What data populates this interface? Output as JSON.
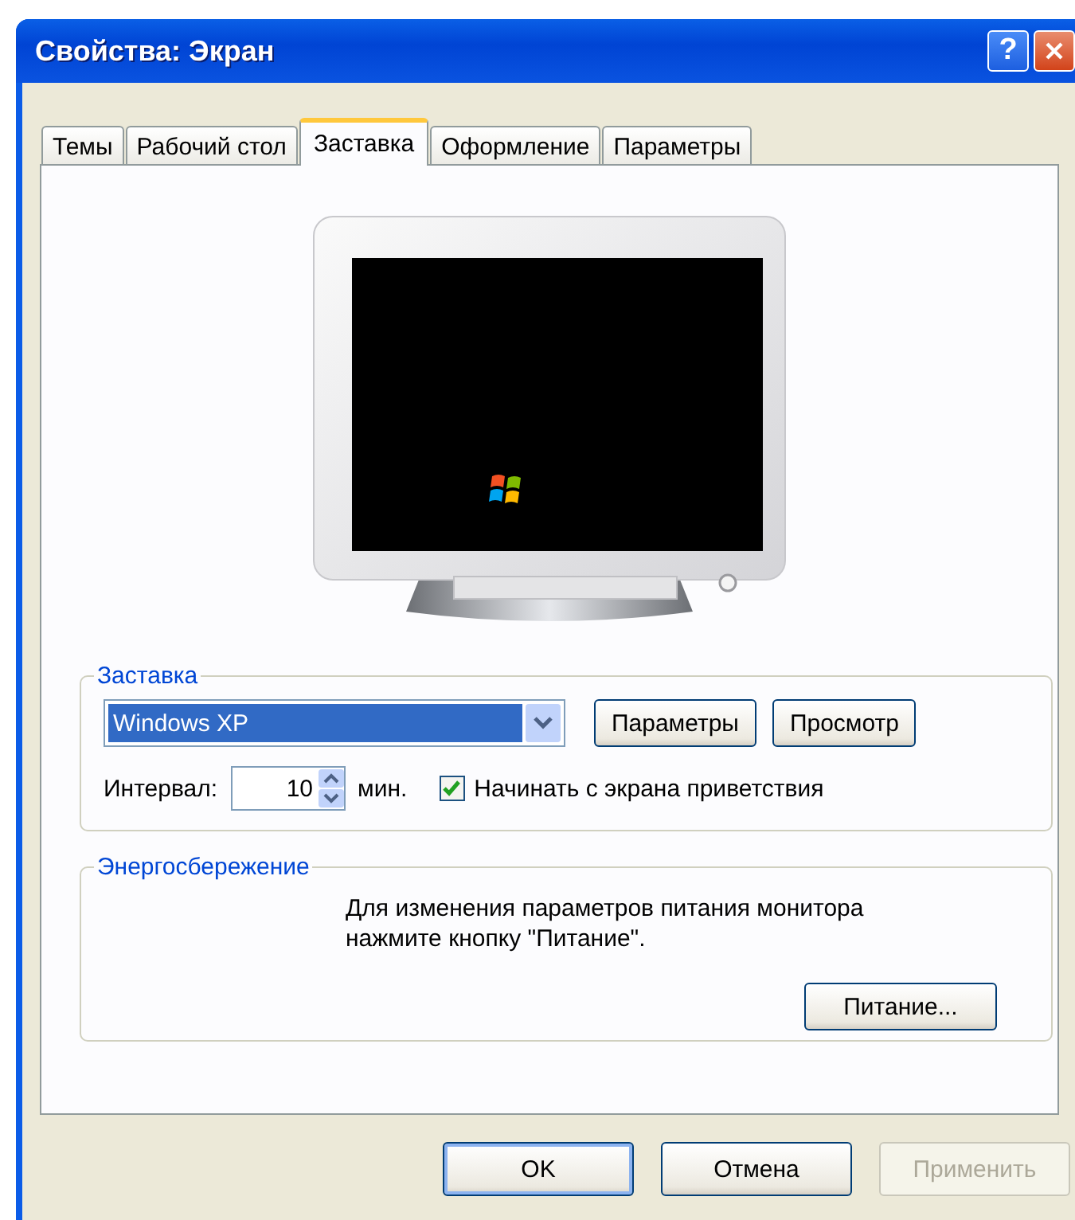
{
  "window": {
    "title": "Свойства: Экран"
  },
  "title_buttons": [
    {
      "kind": "help",
      "label": "?"
    },
    {
      "kind": "close"
    }
  ],
  "tabs": [
    {
      "label": "Темы",
      "selected": false
    },
    {
      "label": "Рабочий стол",
      "selected": false
    },
    {
      "label": "Заставка",
      "selected": true
    },
    {
      "label": "Оформление",
      "selected": false
    },
    {
      "label": "Параметры",
      "selected": false
    }
  ],
  "screensaver_group": {
    "title": "Заставка",
    "dropdown": {
      "value": "Windows XP",
      "focused": true
    },
    "buttons": [
      "Параметры",
      "Просмотр"
    ],
    "interval": {
      "label": "Интервал:",
      "value": "10",
      "unit": "мин."
    },
    "welcome_checkbox": {
      "label": "Начинать с экрана приветствия",
      "checked": true
    }
  },
  "power_group": {
    "title": "Энергосбережение",
    "text": "Для изменения параметров питания монитора\nнажмите кнопку \"Питание\".",
    "button": "Питание..."
  },
  "dialog_buttons": [
    {
      "label": "OK",
      "disabled": false,
      "default": true
    },
    {
      "label": "Отмена",
      "disabled": false,
      "default": false
    },
    {
      "label": "Применить",
      "disabled": true,
      "default": false
    }
  ]
}
